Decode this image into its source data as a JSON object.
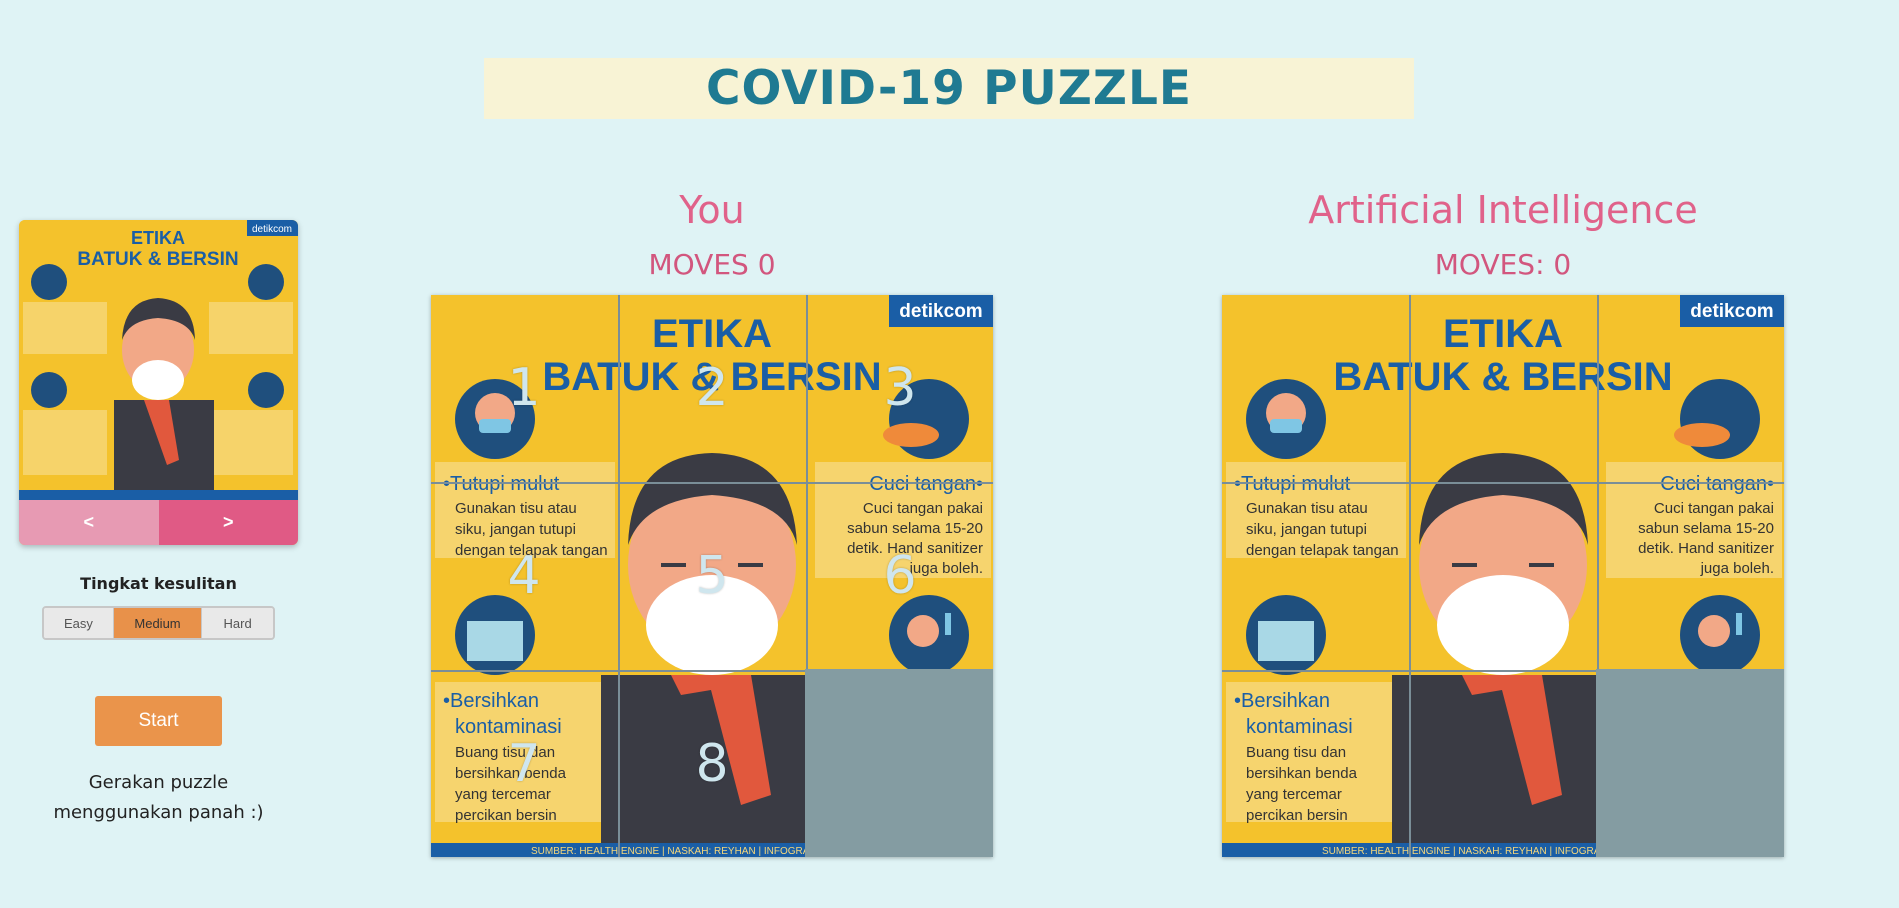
{
  "header": {
    "title": "COVID-19 PUZZLE"
  },
  "preview": {
    "poster_title_line1": "ETIKA",
    "poster_title_line2": "BATUK & BERSIN",
    "brand": "detikcom",
    "prev_label": "<",
    "next_label": ">"
  },
  "difficulty": {
    "label": "Tingkat kesulitan",
    "options": [
      "Easy",
      "Medium",
      "Hard"
    ],
    "selected": "Medium"
  },
  "start_label": "Start",
  "hint_line1": "Gerakan puzzle",
  "hint_line2": "menggunakan panah :)",
  "player": {
    "title": "You",
    "moves_text": "MOVES 0",
    "tile_numbers": [
      "1",
      "2",
      "3",
      "4",
      "5",
      "6",
      "7",
      "8"
    ]
  },
  "ai": {
    "title": "Artificial Intelligence",
    "moves_text": "MOVES: 0"
  },
  "poster": {
    "title_line1": "ETIKA",
    "title_line2": "BATUK & BERSIN",
    "brand": "detikcom",
    "item1": "•Tutupi mulut",
    "item1_desc": [
      "Gunakan tisu atau",
      "siku, jangan tutupi",
      "dengan telapak tangan"
    ],
    "item2": "Cuci tangan•",
    "item2_desc": [
      "Cuci tangan pakai",
      "sabun selama 15-20",
      "detik. Hand sanitizer",
      "juga boleh."
    ],
    "item3": "•Bersihkan",
    "item3b": "kontaminasi",
    "item3_desc": [
      "Buang tisu dan",
      "bersihkan benda",
      "yang tercemar",
      "percikan bersin"
    ],
    "footer": "SUMBER: HEALTH ENGINE | NASKAH: REYHAN | INFOGRAFIS: AH"
  },
  "colors": {
    "background": "#dff3f5",
    "accent_pink": "#e0628a",
    "title_blue": "#1f7a92",
    "button_orange": "#ea944b"
  }
}
